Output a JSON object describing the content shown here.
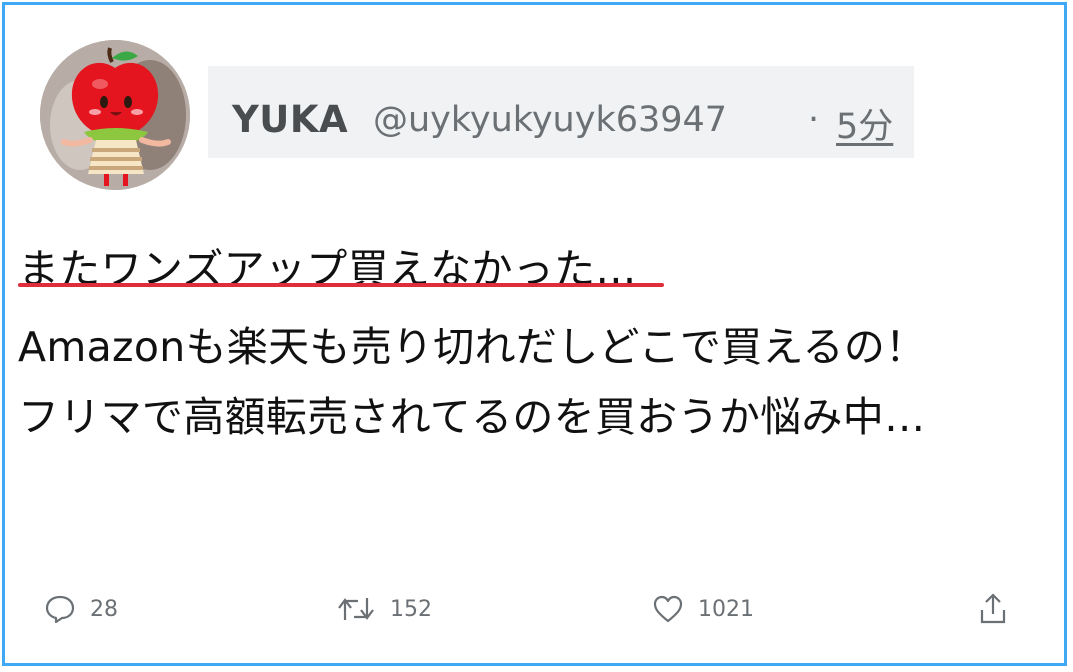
{
  "tweet": {
    "display_name": "YUKA",
    "handle": "@uykyukyuyk63947",
    "separator": "·",
    "time": "5分",
    "lines": [
      "またワンズアップ買えなかった…",
      "Amazonも楽天も売り切れだしどこで買えるの！",
      "フリマで高額転売されてるのを買おうか悩み中…"
    ]
  },
  "actions": {
    "reply_count": "28",
    "retweet_count": "152",
    "like_count": "1021"
  },
  "icons": [
    "avatar-apple-character",
    "reply-icon",
    "retweet-icon",
    "like-icon",
    "share-icon"
  ],
  "colors": {
    "frame_border": "#3fa9f5",
    "highlight_underline": "#e02d3b",
    "text": "#111111",
    "muted": "#6b7075"
  }
}
